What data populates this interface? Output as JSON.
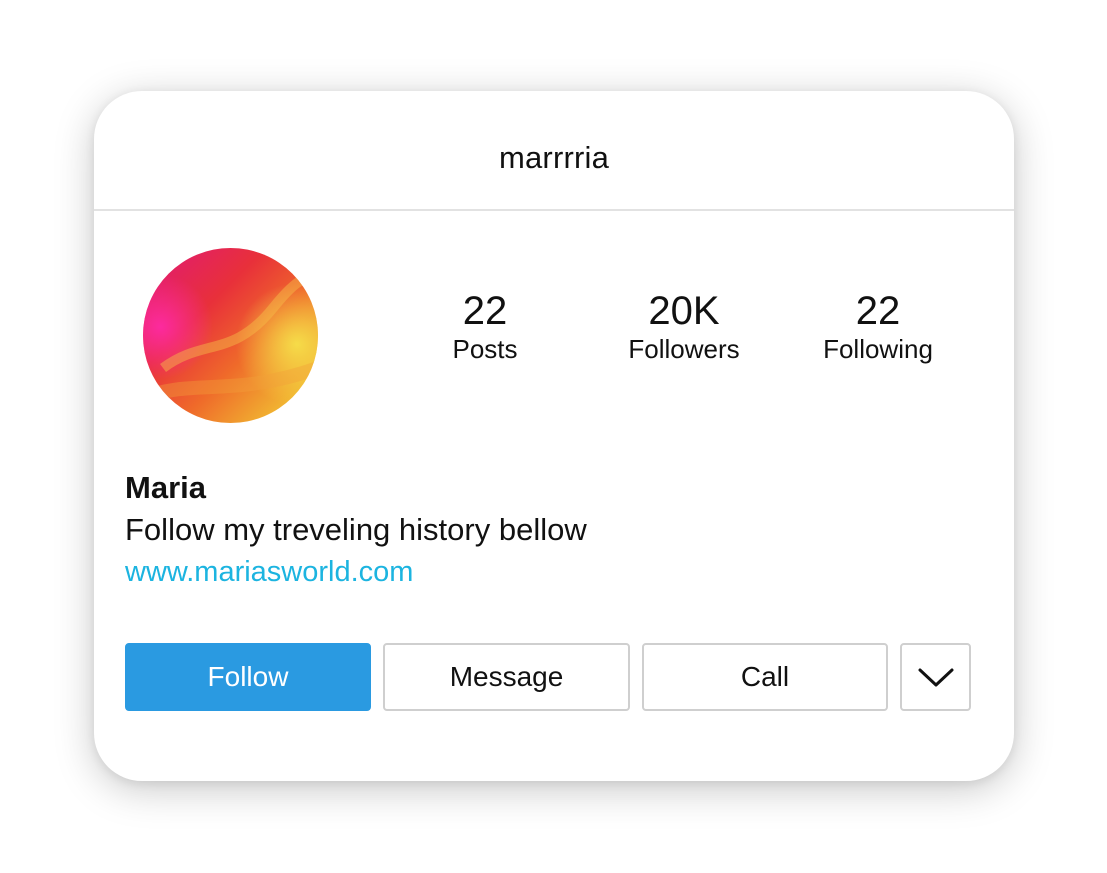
{
  "header": {
    "username": "marrrria"
  },
  "stats": {
    "posts": {
      "value": "22",
      "label": "Posts"
    },
    "followers": {
      "value": "20K",
      "label": "Followers"
    },
    "following": {
      "value": "22",
      "label": "Following"
    }
  },
  "bio": {
    "name": "Maria",
    "text": "Follow my treveling history bellow",
    "link": "www.mariasworld.com"
  },
  "actions": {
    "follow_label": "Follow",
    "message_label": "Message",
    "call_label": "Call",
    "more_icon": "chevron-down-icon"
  },
  "colors": {
    "follow_button": "#2a9ae1",
    "link": "#1cb4e0"
  }
}
